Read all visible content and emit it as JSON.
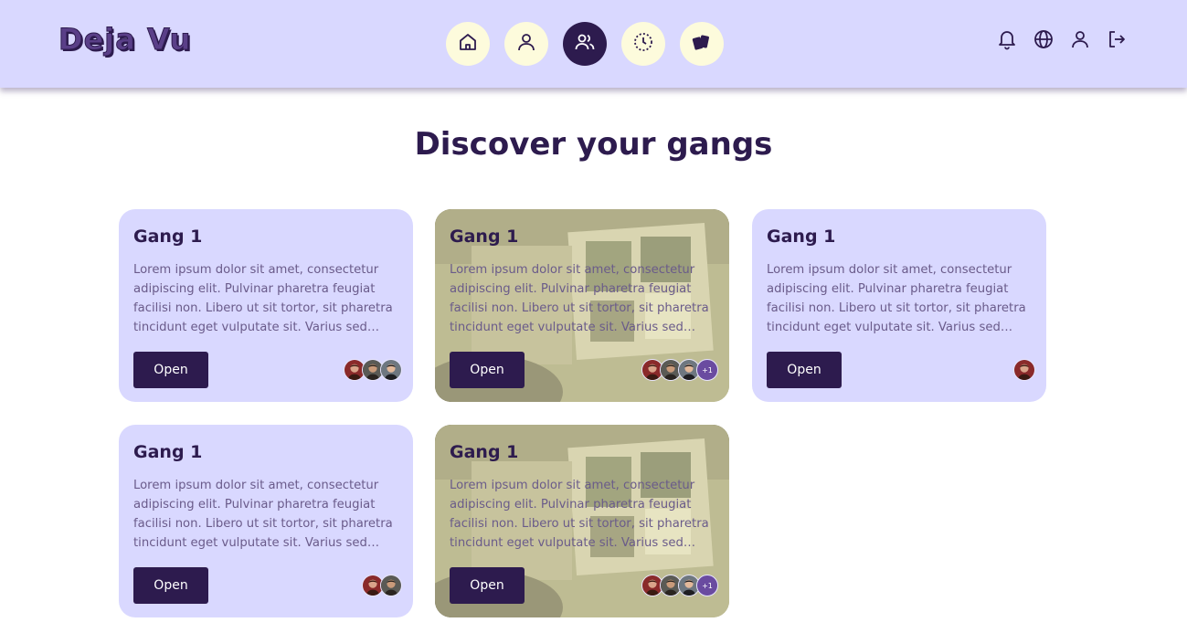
{
  "app": {
    "logo_text": "Deja Vu"
  },
  "nav": {
    "items": [
      {
        "icon": "home-icon",
        "active": false
      },
      {
        "icon": "user-icon",
        "active": false
      },
      {
        "icon": "users-icon",
        "active": true
      },
      {
        "icon": "clock-icon",
        "active": false
      },
      {
        "icon": "cards-icon",
        "active": false
      }
    ]
  },
  "header_actions": {
    "items": [
      {
        "icon": "bell-icon"
      },
      {
        "icon": "globe-icon"
      },
      {
        "icon": "profile-icon"
      },
      {
        "icon": "logout-icon"
      }
    ]
  },
  "page": {
    "title": "Discover your gangs"
  },
  "gangs": [
    {
      "title": "Gang 1",
      "description": "Lorem ipsum dolor sit amet, consectetur adipiscing elit. Pulvinar pharetra feugiat facilisi non. Libero ut sit tortor, sit pharetra tincidunt eget vulputate sit. Varius sed aliquet dictum nunc.",
      "button_label": "Open",
      "has_photo": false,
      "members": 3,
      "more_label": ""
    },
    {
      "title": "Gang 1",
      "description": "Lorem ipsum dolor sit amet, consectetur adipiscing elit. Pulvinar pharetra feugiat facilisi non. Libero ut sit tortor, sit pharetra tincidunt eget vulputate sit. Varius sed aliquet dictum nunc.",
      "button_label": "Open",
      "has_photo": true,
      "members": 3,
      "more_label": "+1"
    },
    {
      "title": "Gang 1",
      "description": "Lorem ipsum dolor sit amet, consectetur adipiscing elit. Pulvinar pharetra feugiat facilisi non. Libero ut sit tortor, sit pharetra tincidunt eget vulputate sit. Varius sed aliquet dictum nunc.",
      "button_label": "Open",
      "has_photo": false,
      "members": 1,
      "more_label": ""
    },
    {
      "title": "Gang 1",
      "description": "Lorem ipsum dolor sit amet, consectetur adipiscing elit. Pulvinar pharetra feugiat facilisi non. Libero ut sit tortor, sit pharetra tincidunt eget vulputate sit. Varius sed aliquet dictum nunc.",
      "button_label": "Open",
      "has_photo": false,
      "members": 2,
      "more_label": ""
    },
    {
      "title": "Gang 1",
      "description": "Lorem ipsum dolor sit amet, consectetur adipiscing elit. Pulvinar pharetra feugiat facilisi non. Libero ut sit tortor, sit pharetra tincidunt eget vulputate sit. Varius sed aliquet dictum nunc.",
      "button_label": "Open",
      "has_photo": true,
      "members": 3,
      "more_label": "+1"
    }
  ],
  "colors": {
    "primary": "#2d1b4e",
    "header_bg": "#d9d8ff",
    "card_bg": "#d9d8ff",
    "nav_bg": "#fdfbdc",
    "badge_bg": "#6a4ba0"
  }
}
